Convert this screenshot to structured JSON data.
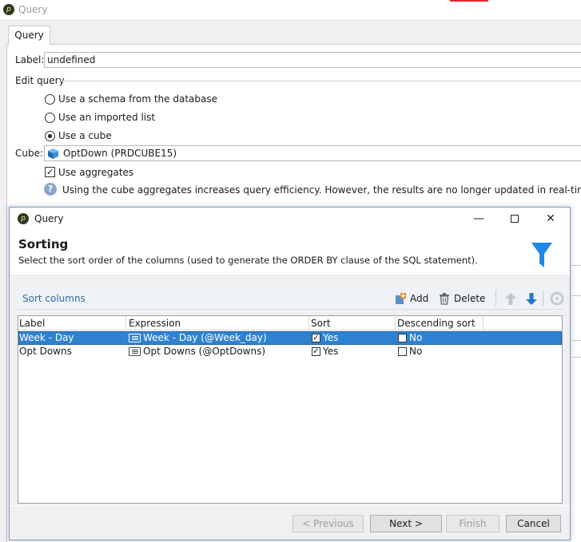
{
  "background_window": {
    "title": "Query",
    "tab": "Query",
    "label_caption": "Label:",
    "label_value": "undefined",
    "edit_query_caption": "Edit query",
    "options": [
      {
        "label": "Use a schema from the database",
        "selected": false
      },
      {
        "label": "Use an imported list",
        "selected": false
      },
      {
        "label": "Use a cube",
        "selected": true
      }
    ],
    "cube_caption": "Cube:",
    "cube_value": "OptDown (PRDCUBE15)",
    "use_aggregates_label": "Use aggregates",
    "use_aggregates_checked": true,
    "info_text": "Using the cube aggregates increases query efficiency. However, the results are no longer updated in real-time. The data disp"
  },
  "dialog": {
    "title": "Query",
    "heading": "Sorting",
    "description": "Select the sort order of the columns (used to generate the ORDER BY clause of the SQL statement).",
    "section_title": "Sort columns",
    "toolbar": {
      "add_label": "Add",
      "delete_label": "Delete"
    },
    "columns": [
      "Label",
      "Expression",
      "Sort",
      "Descending sort"
    ],
    "rows": [
      {
        "label": "Week - Day",
        "expression": "Week - Day (@Week_day)",
        "sort": "Yes",
        "sort_checked": true,
        "descending": "No",
        "descending_checked": false,
        "selected": true
      },
      {
        "label": "Opt Downs",
        "expression": "Opt Downs (@OptDowns)",
        "sort": "Yes",
        "sort_checked": true,
        "descending": "No",
        "descending_checked": false,
        "selected": false
      }
    ],
    "buttons": {
      "previous": "< Previous",
      "next": "Next >",
      "finish": "Finish",
      "cancel": "Cancel"
    }
  },
  "colors": {
    "selection": "#2f82d0",
    "filter_icon": "#1e88e5",
    "link": "#2f6ea5"
  }
}
